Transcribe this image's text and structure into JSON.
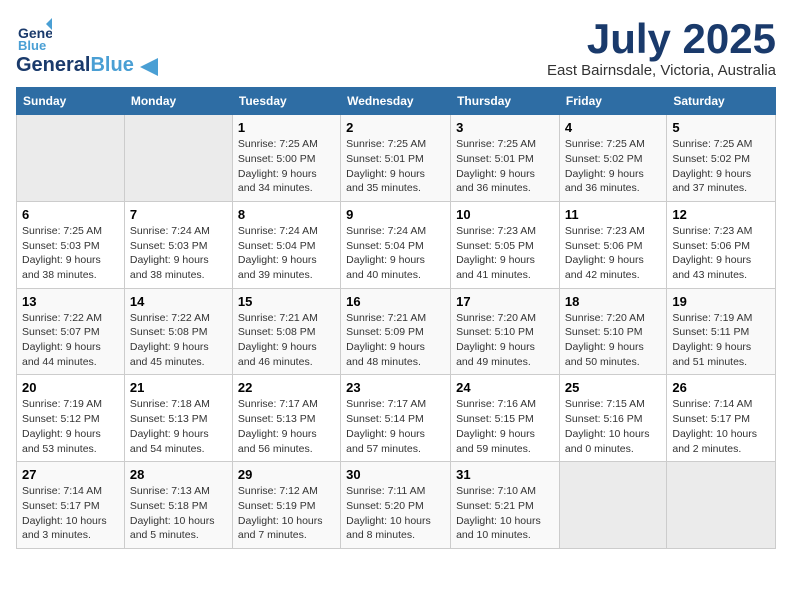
{
  "logo": {
    "line1": "General",
    "line2": "Blue"
  },
  "header": {
    "title": "July 2025",
    "subtitle": "East Bairnsdale, Victoria, Australia"
  },
  "days_of_week": [
    "Sunday",
    "Monday",
    "Tuesday",
    "Wednesday",
    "Thursday",
    "Friday",
    "Saturday"
  ],
  "weeks": [
    [
      {
        "day": "",
        "info": ""
      },
      {
        "day": "",
        "info": ""
      },
      {
        "day": "1",
        "info": "Sunrise: 7:25 AM\nSunset: 5:00 PM\nDaylight: 9 hours and 34 minutes."
      },
      {
        "day": "2",
        "info": "Sunrise: 7:25 AM\nSunset: 5:01 PM\nDaylight: 9 hours and 35 minutes."
      },
      {
        "day": "3",
        "info": "Sunrise: 7:25 AM\nSunset: 5:01 PM\nDaylight: 9 hours and 36 minutes."
      },
      {
        "day": "4",
        "info": "Sunrise: 7:25 AM\nSunset: 5:02 PM\nDaylight: 9 hours and 36 minutes."
      },
      {
        "day": "5",
        "info": "Sunrise: 7:25 AM\nSunset: 5:02 PM\nDaylight: 9 hours and 37 minutes."
      }
    ],
    [
      {
        "day": "6",
        "info": "Sunrise: 7:25 AM\nSunset: 5:03 PM\nDaylight: 9 hours and 38 minutes."
      },
      {
        "day": "7",
        "info": "Sunrise: 7:24 AM\nSunset: 5:03 PM\nDaylight: 9 hours and 38 minutes."
      },
      {
        "day": "8",
        "info": "Sunrise: 7:24 AM\nSunset: 5:04 PM\nDaylight: 9 hours and 39 minutes."
      },
      {
        "day": "9",
        "info": "Sunrise: 7:24 AM\nSunset: 5:04 PM\nDaylight: 9 hours and 40 minutes."
      },
      {
        "day": "10",
        "info": "Sunrise: 7:23 AM\nSunset: 5:05 PM\nDaylight: 9 hours and 41 minutes."
      },
      {
        "day": "11",
        "info": "Sunrise: 7:23 AM\nSunset: 5:06 PM\nDaylight: 9 hours and 42 minutes."
      },
      {
        "day": "12",
        "info": "Sunrise: 7:23 AM\nSunset: 5:06 PM\nDaylight: 9 hours and 43 minutes."
      }
    ],
    [
      {
        "day": "13",
        "info": "Sunrise: 7:22 AM\nSunset: 5:07 PM\nDaylight: 9 hours and 44 minutes."
      },
      {
        "day": "14",
        "info": "Sunrise: 7:22 AM\nSunset: 5:08 PM\nDaylight: 9 hours and 45 minutes."
      },
      {
        "day": "15",
        "info": "Sunrise: 7:21 AM\nSunset: 5:08 PM\nDaylight: 9 hours and 46 minutes."
      },
      {
        "day": "16",
        "info": "Sunrise: 7:21 AM\nSunset: 5:09 PM\nDaylight: 9 hours and 48 minutes."
      },
      {
        "day": "17",
        "info": "Sunrise: 7:20 AM\nSunset: 5:10 PM\nDaylight: 9 hours and 49 minutes."
      },
      {
        "day": "18",
        "info": "Sunrise: 7:20 AM\nSunset: 5:10 PM\nDaylight: 9 hours and 50 minutes."
      },
      {
        "day": "19",
        "info": "Sunrise: 7:19 AM\nSunset: 5:11 PM\nDaylight: 9 hours and 51 minutes."
      }
    ],
    [
      {
        "day": "20",
        "info": "Sunrise: 7:19 AM\nSunset: 5:12 PM\nDaylight: 9 hours and 53 minutes."
      },
      {
        "day": "21",
        "info": "Sunrise: 7:18 AM\nSunset: 5:13 PM\nDaylight: 9 hours and 54 minutes."
      },
      {
        "day": "22",
        "info": "Sunrise: 7:17 AM\nSunset: 5:13 PM\nDaylight: 9 hours and 56 minutes."
      },
      {
        "day": "23",
        "info": "Sunrise: 7:17 AM\nSunset: 5:14 PM\nDaylight: 9 hours and 57 minutes."
      },
      {
        "day": "24",
        "info": "Sunrise: 7:16 AM\nSunset: 5:15 PM\nDaylight: 9 hours and 59 minutes."
      },
      {
        "day": "25",
        "info": "Sunrise: 7:15 AM\nSunset: 5:16 PM\nDaylight: 10 hours and 0 minutes."
      },
      {
        "day": "26",
        "info": "Sunrise: 7:14 AM\nSunset: 5:17 PM\nDaylight: 10 hours and 2 minutes."
      }
    ],
    [
      {
        "day": "27",
        "info": "Sunrise: 7:14 AM\nSunset: 5:17 PM\nDaylight: 10 hours and 3 minutes."
      },
      {
        "day": "28",
        "info": "Sunrise: 7:13 AM\nSunset: 5:18 PM\nDaylight: 10 hours and 5 minutes."
      },
      {
        "day": "29",
        "info": "Sunrise: 7:12 AM\nSunset: 5:19 PM\nDaylight: 10 hours and 7 minutes."
      },
      {
        "day": "30",
        "info": "Sunrise: 7:11 AM\nSunset: 5:20 PM\nDaylight: 10 hours and 8 minutes."
      },
      {
        "day": "31",
        "info": "Sunrise: 7:10 AM\nSunset: 5:21 PM\nDaylight: 10 hours and 10 minutes."
      },
      {
        "day": "",
        "info": ""
      },
      {
        "day": "",
        "info": ""
      }
    ]
  ]
}
